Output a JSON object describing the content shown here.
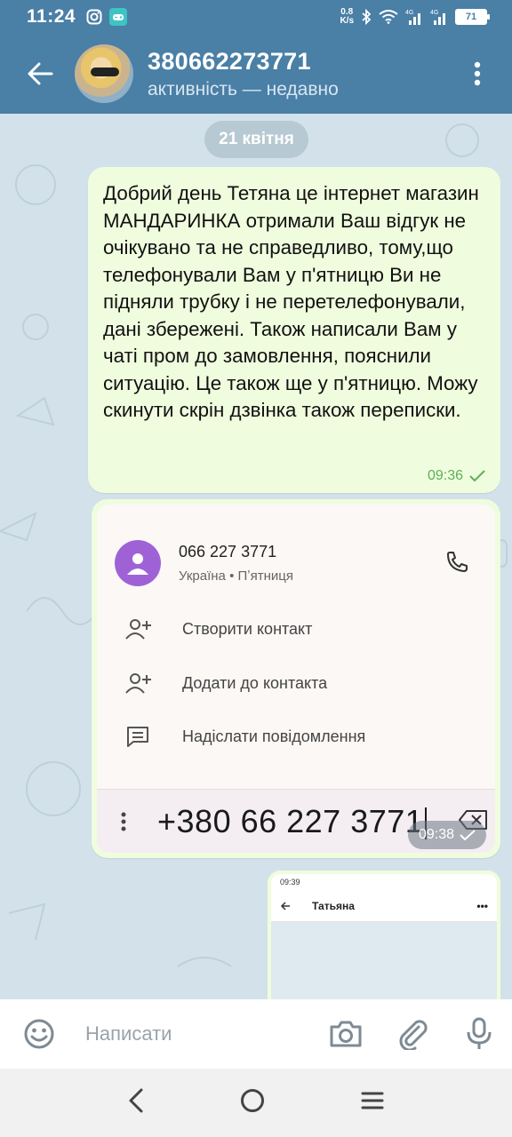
{
  "status_bar": {
    "time": "11:24",
    "net_speed_value": "0.8",
    "net_speed_unit": "K/s",
    "signal1": "4G",
    "signal2": "4G",
    "battery": "71"
  },
  "header": {
    "title": "380662273771",
    "subtitle": "активність — недавно"
  },
  "chat": {
    "date_label": "21 квітня",
    "messages": [
      {
        "text": "Добрий день Тетяна це інтернет магазин МАНДАРИНКА отримали Ваш відгук не очікувано та не справедливо, тому,що телефонували Вам у п'ятницю Ви не підняли трубку і не перетелефонували, дані збережені. Також написали Вам у чаті пром до замовлення, пояснили ситуацію. Це також ще у п'ятницю. Можу скинути скрін дзвінка також переписки.",
        "time": "09:36"
      }
    ],
    "image_message": {
      "time": "09:38",
      "contact_number": "066 227 3771",
      "contact_details": "Україна • Пʼятниця",
      "actions": [
        "Створити контакт",
        "Додати до контакта",
        "Надіслати повідомлення"
      ],
      "dialed_number": "+380 66 227 3771"
    },
    "image_message2": {
      "time": "09:39",
      "title": "Татьяна",
      "more": "•••"
    }
  },
  "input": {
    "placeholder": "Написати"
  },
  "colors": {
    "header_bg": "#4a7fa6",
    "bubble_out": "#effdde",
    "check_green": "#5fae5a",
    "contact_avatar": "#9f62d6"
  }
}
